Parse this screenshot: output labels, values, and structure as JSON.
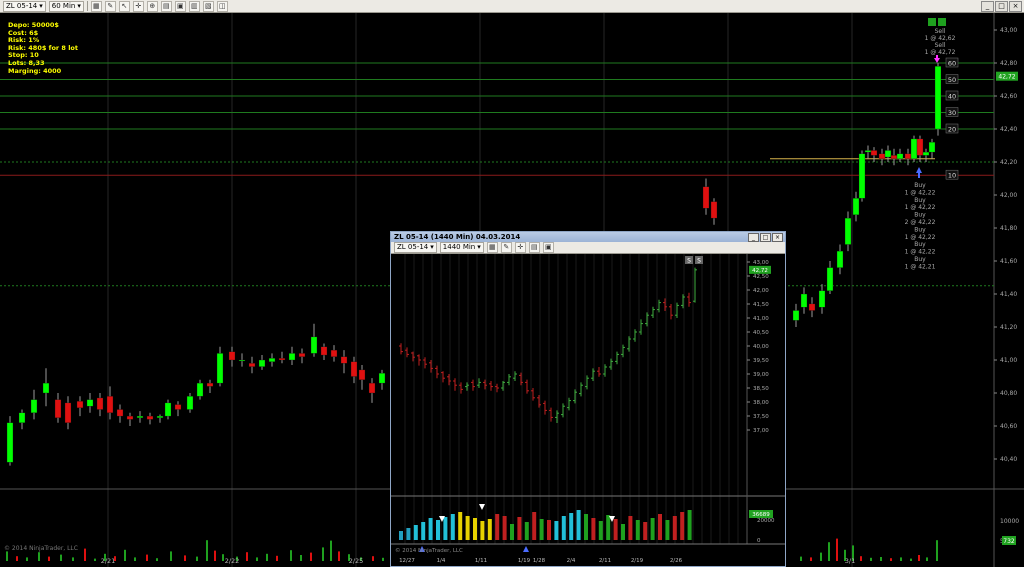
{
  "toolbar": {
    "instrument": "ZL 05-14",
    "period": "60 Min",
    "icons": [
      "pencil-icon",
      "crosshair-icon",
      "chart-style-icon",
      "data-box-icon",
      "properties-icon"
    ]
  },
  "info_panel": {
    "lines": [
      "Depo: 50000$",
      "Cost: 6$",
      "Risk: 1%",
      "Risk: 480$  for 8 lot",
      "Stop: 10",
      "Lots: 8,33",
      "Marging: 4000"
    ]
  },
  "main_chart": {
    "price_ticks": [
      "43,00",
      "42,80",
      "42,60",
      "42,40",
      "42,20",
      "42,00",
      "41,80",
      "41,60",
      "41,40",
      "41,20",
      "41,00",
      "40,80",
      "40,60",
      "40,40"
    ],
    "last_price": "42,72",
    "level_labels": [
      "60",
      "50",
      "40",
      "30",
      "20",
      "10"
    ],
    "volume_ticks": [
      "10000",
      "5000"
    ],
    "volume_last": "732",
    "date_labels": [
      "2/21",
      "2/22",
      "2/25",
      "3/1"
    ],
    "copyright": "© 2014 NinjaTrader, LLC",
    "sell_annotation": [
      "Sell",
      "1 @ 42,62",
      "Sell",
      "1 @ 42,72"
    ],
    "buy_annotation": [
      "Buy",
      "1 @ 42,22",
      "Buy",
      "1 @ 42,22",
      "Buy",
      "2 @ 42,22",
      "Buy",
      "1 @ 42,22",
      "Buy",
      "1 @ 42,22",
      "Buy",
      "1 @ 42,21"
    ]
  },
  "inset_chart": {
    "title": "ZL 05-14 (1440 Min)  04.03.2014",
    "instrument": "ZL 05-14",
    "period": "1440 Min",
    "price_ticks": [
      "43,00",
      "42,50",
      "42,00",
      "41,50",
      "41,00",
      "40,50",
      "40,00",
      "39,50",
      "39,00",
      "38,50",
      "38,00",
      "37,50",
      "37,00"
    ],
    "last_price": "42,72",
    "volume_ticks": [
      "20000",
      "0"
    ],
    "volume_last": "36689",
    "date_labels": [
      "12/27",
      "1/4",
      "1/11",
      "1/19",
      "1/28",
      "2/4",
      "2/11",
      "2/19",
      "2/26"
    ],
    "copyright": "© 2014 NinjaTrader, LLC",
    "marker_labels": [
      "S",
      "S"
    ]
  },
  "colors": {
    "background": "#000000",
    "up_candle": "#00ff00",
    "down_candle": "#e01010",
    "grid": "#2a2a2a",
    "level_line": "#1f7a1f",
    "stop_line": "#8a1b1b",
    "info_text": "#ffff00"
  }
}
